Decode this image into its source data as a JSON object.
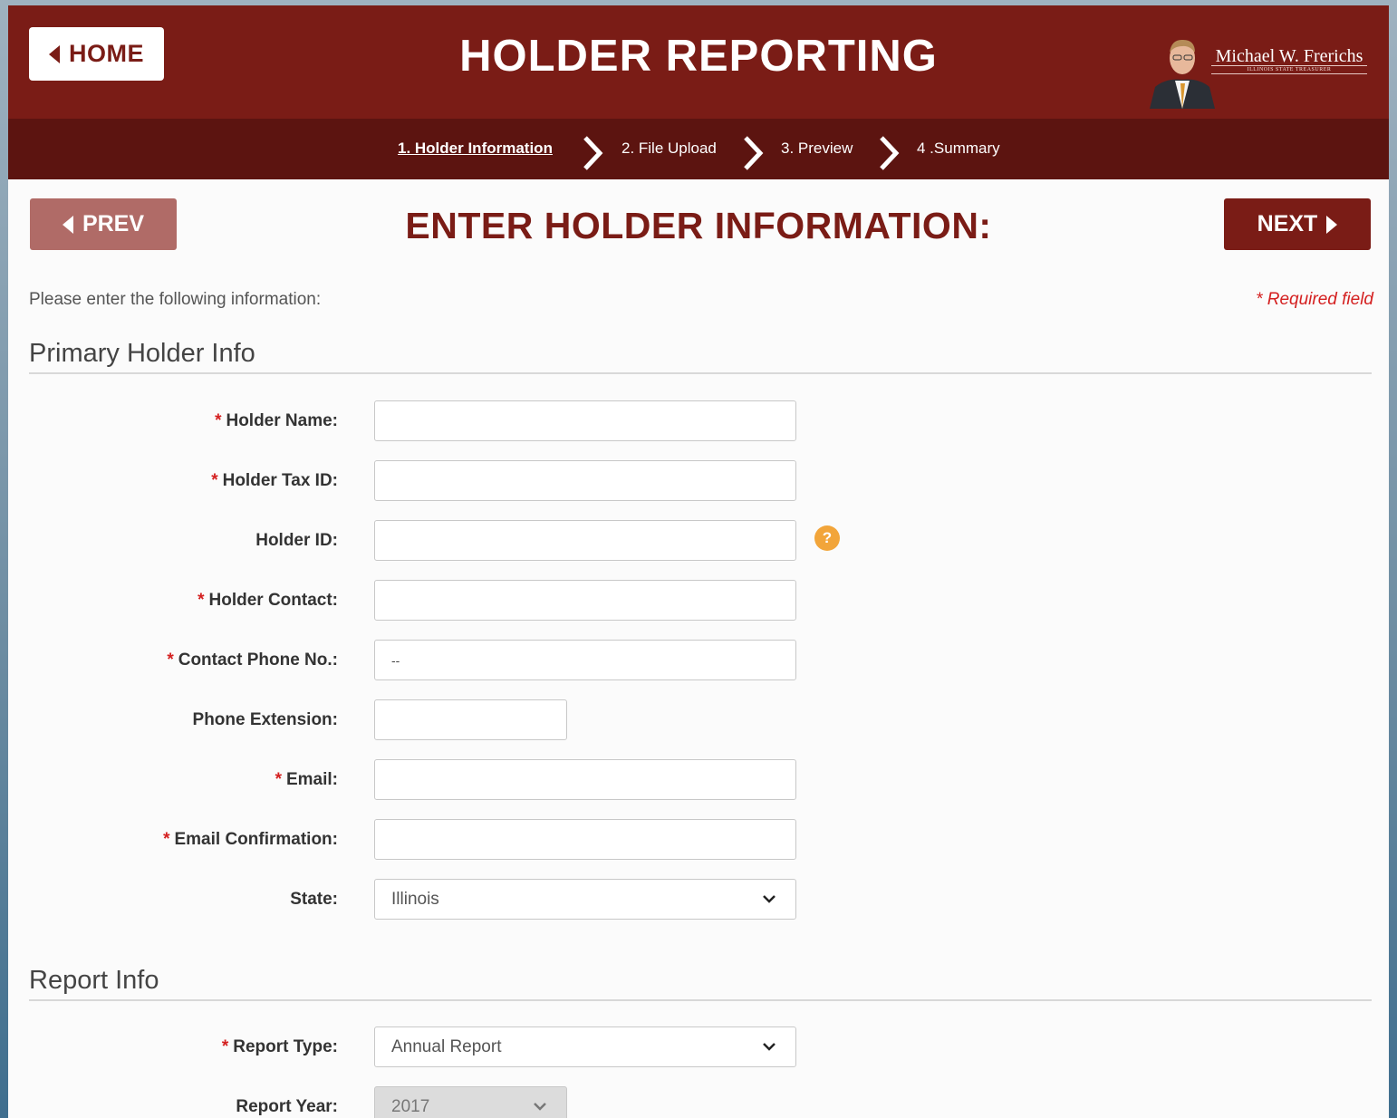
{
  "header": {
    "home_label": "HOME",
    "title": "HOLDER REPORTING",
    "brand_name": "Michael W. Frerichs",
    "brand_subtitle": "ILLINOIS STATE TREASURER"
  },
  "steps": [
    {
      "label": "1. Holder Information",
      "active": true
    },
    {
      "label": "2. File Upload",
      "active": false
    },
    {
      "label": "3. Preview",
      "active": false
    },
    {
      "label": "4 .Summary",
      "active": false
    }
  ],
  "nav": {
    "prev_label": "PREV",
    "next_label": "NEXT",
    "page_title": "ENTER HOLDER INFORMATION:"
  },
  "intro": "Please enter the following information:",
  "required_note": "* Required field",
  "required_marker": "*",
  "sections": {
    "primary": "Primary Holder Info",
    "report": "Report Info"
  },
  "fields": {
    "holder_name": {
      "label": "Holder Name:",
      "required": true,
      "value": ""
    },
    "holder_tax_id": {
      "label": "Holder Tax ID:",
      "required": true,
      "value": ""
    },
    "holder_id": {
      "label": "Holder ID:",
      "required": false,
      "value": "",
      "help_icon": "?"
    },
    "holder_contact": {
      "label": "Holder Contact:",
      "required": true,
      "value": ""
    },
    "contact_phone": {
      "label": "Contact Phone No.:",
      "required": true,
      "value": "--"
    },
    "phone_extension": {
      "label": "Phone Extension:",
      "required": false,
      "value": ""
    },
    "email": {
      "label": "Email:",
      "required": true,
      "value": ""
    },
    "email_confirmation": {
      "label": "Email Confirmation:",
      "required": true,
      "value": ""
    },
    "state": {
      "label": "State:",
      "required": false,
      "value": "Illinois"
    },
    "report_type": {
      "label": "Report Type:",
      "required": true,
      "value": "Annual Report"
    },
    "report_year": {
      "label": "Report Year:",
      "required": false,
      "value": "2017"
    }
  },
  "colors": {
    "brand": "#7a1c16",
    "steps_bar": "#5c1410",
    "prev_button": "#b06b67",
    "required": "#d42020",
    "help_icon": "#f2a53a"
  }
}
